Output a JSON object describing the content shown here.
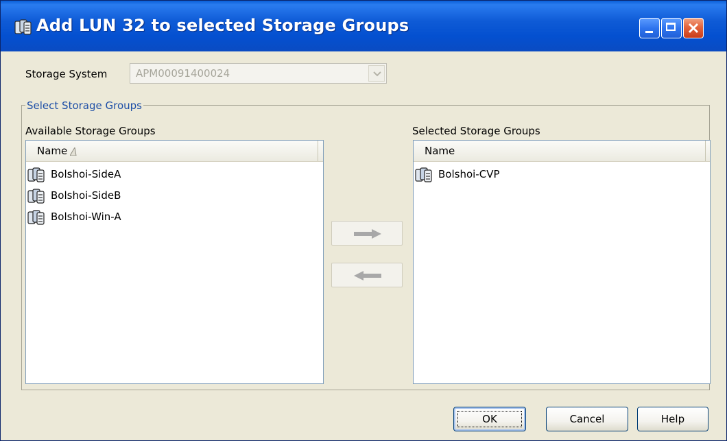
{
  "window": {
    "title": "Add LUN 32 to selected Storage Groups",
    "icon": "storage-group-icon",
    "controls": [
      "minimize-icon",
      "maximize-icon",
      "close-icon"
    ]
  },
  "storage_system": {
    "label": "Storage System",
    "value": "APM00091400024",
    "disabled": true
  },
  "group_box": {
    "title": "Select Storage Groups"
  },
  "available": {
    "label": "Available Storage Groups",
    "column": "Name",
    "sort": "ascending",
    "items": [
      "Bolshoi-SideA",
      "Bolshoi-SideB",
      "Bolshoi-Win-A"
    ]
  },
  "selected": {
    "label": "Selected Storage Groups",
    "column": "Name",
    "items": [
      "Bolshoi-CVP"
    ]
  },
  "move_buttons": [
    "arrow-right-icon",
    "arrow-left-icon"
  ],
  "buttons": {
    "ok": "OK",
    "cancel": "Cancel",
    "help": "Help"
  },
  "colors": {
    "titlebar": "#0450d0",
    "window_bg": "#ece9d8",
    "group_title": "#1d4ea6"
  }
}
